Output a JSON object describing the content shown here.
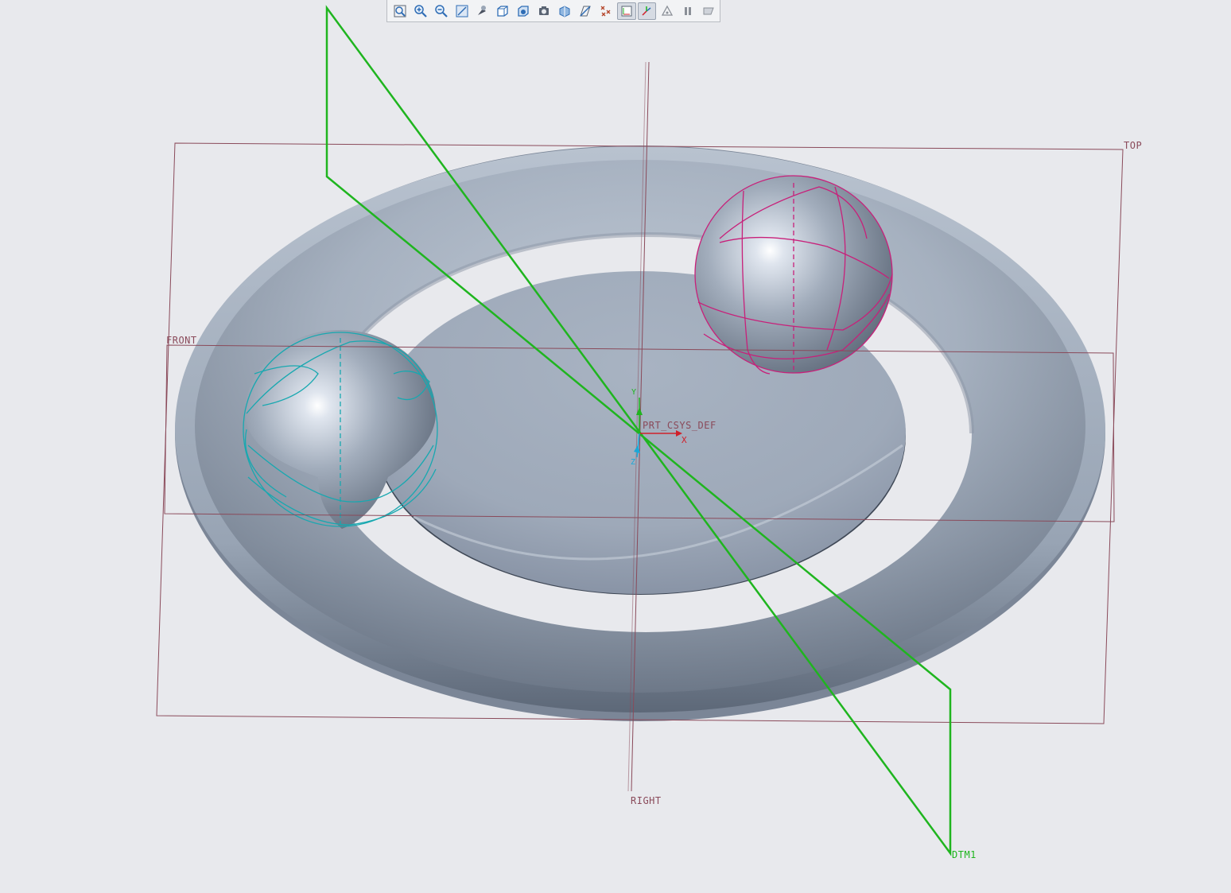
{
  "toolbar": {
    "items": [
      {
        "name": "refit-icon",
        "active": false
      },
      {
        "name": "zoom-in-icon",
        "active": false
      },
      {
        "name": "zoom-out-icon",
        "active": false
      },
      {
        "name": "repaint-icon",
        "active": false
      },
      {
        "name": "display-style-icon",
        "active": false
      },
      {
        "name": "saved-orientations-icon",
        "active": false
      },
      {
        "name": "view-manager-icon",
        "active": false
      },
      {
        "name": "perspective-icon",
        "active": false
      },
      {
        "name": "section-icon",
        "active": false
      },
      {
        "name": "plane-display-icon",
        "active": false
      },
      {
        "name": "point-display-icon",
        "active": false
      },
      {
        "name": "csys-display-icon",
        "active": true
      },
      {
        "name": "axis-display-icon",
        "active": true
      },
      {
        "name": "annotation-display-icon",
        "active": false
      },
      {
        "name": "pause-icon",
        "active": false
      },
      {
        "name": "spin-center-icon",
        "active": false
      }
    ]
  },
  "datum_labels": {
    "top": "TOP",
    "front": "FRONT",
    "right": "RIGHT",
    "dtm1": "DTM1",
    "csys": "PRT_CSYS_DEF",
    "x_axis": "X",
    "y_axis": "Y",
    "z_axis": "Z"
  },
  "colors": {
    "background": "#e8e9ed",
    "datum_plane": "#8a4a5a",
    "dtm1_plane": "#1fb51f",
    "highlight_cyan": "#18a8b0",
    "highlight_magenta": "#c8207a",
    "model_surface": "#9aa6b6"
  }
}
